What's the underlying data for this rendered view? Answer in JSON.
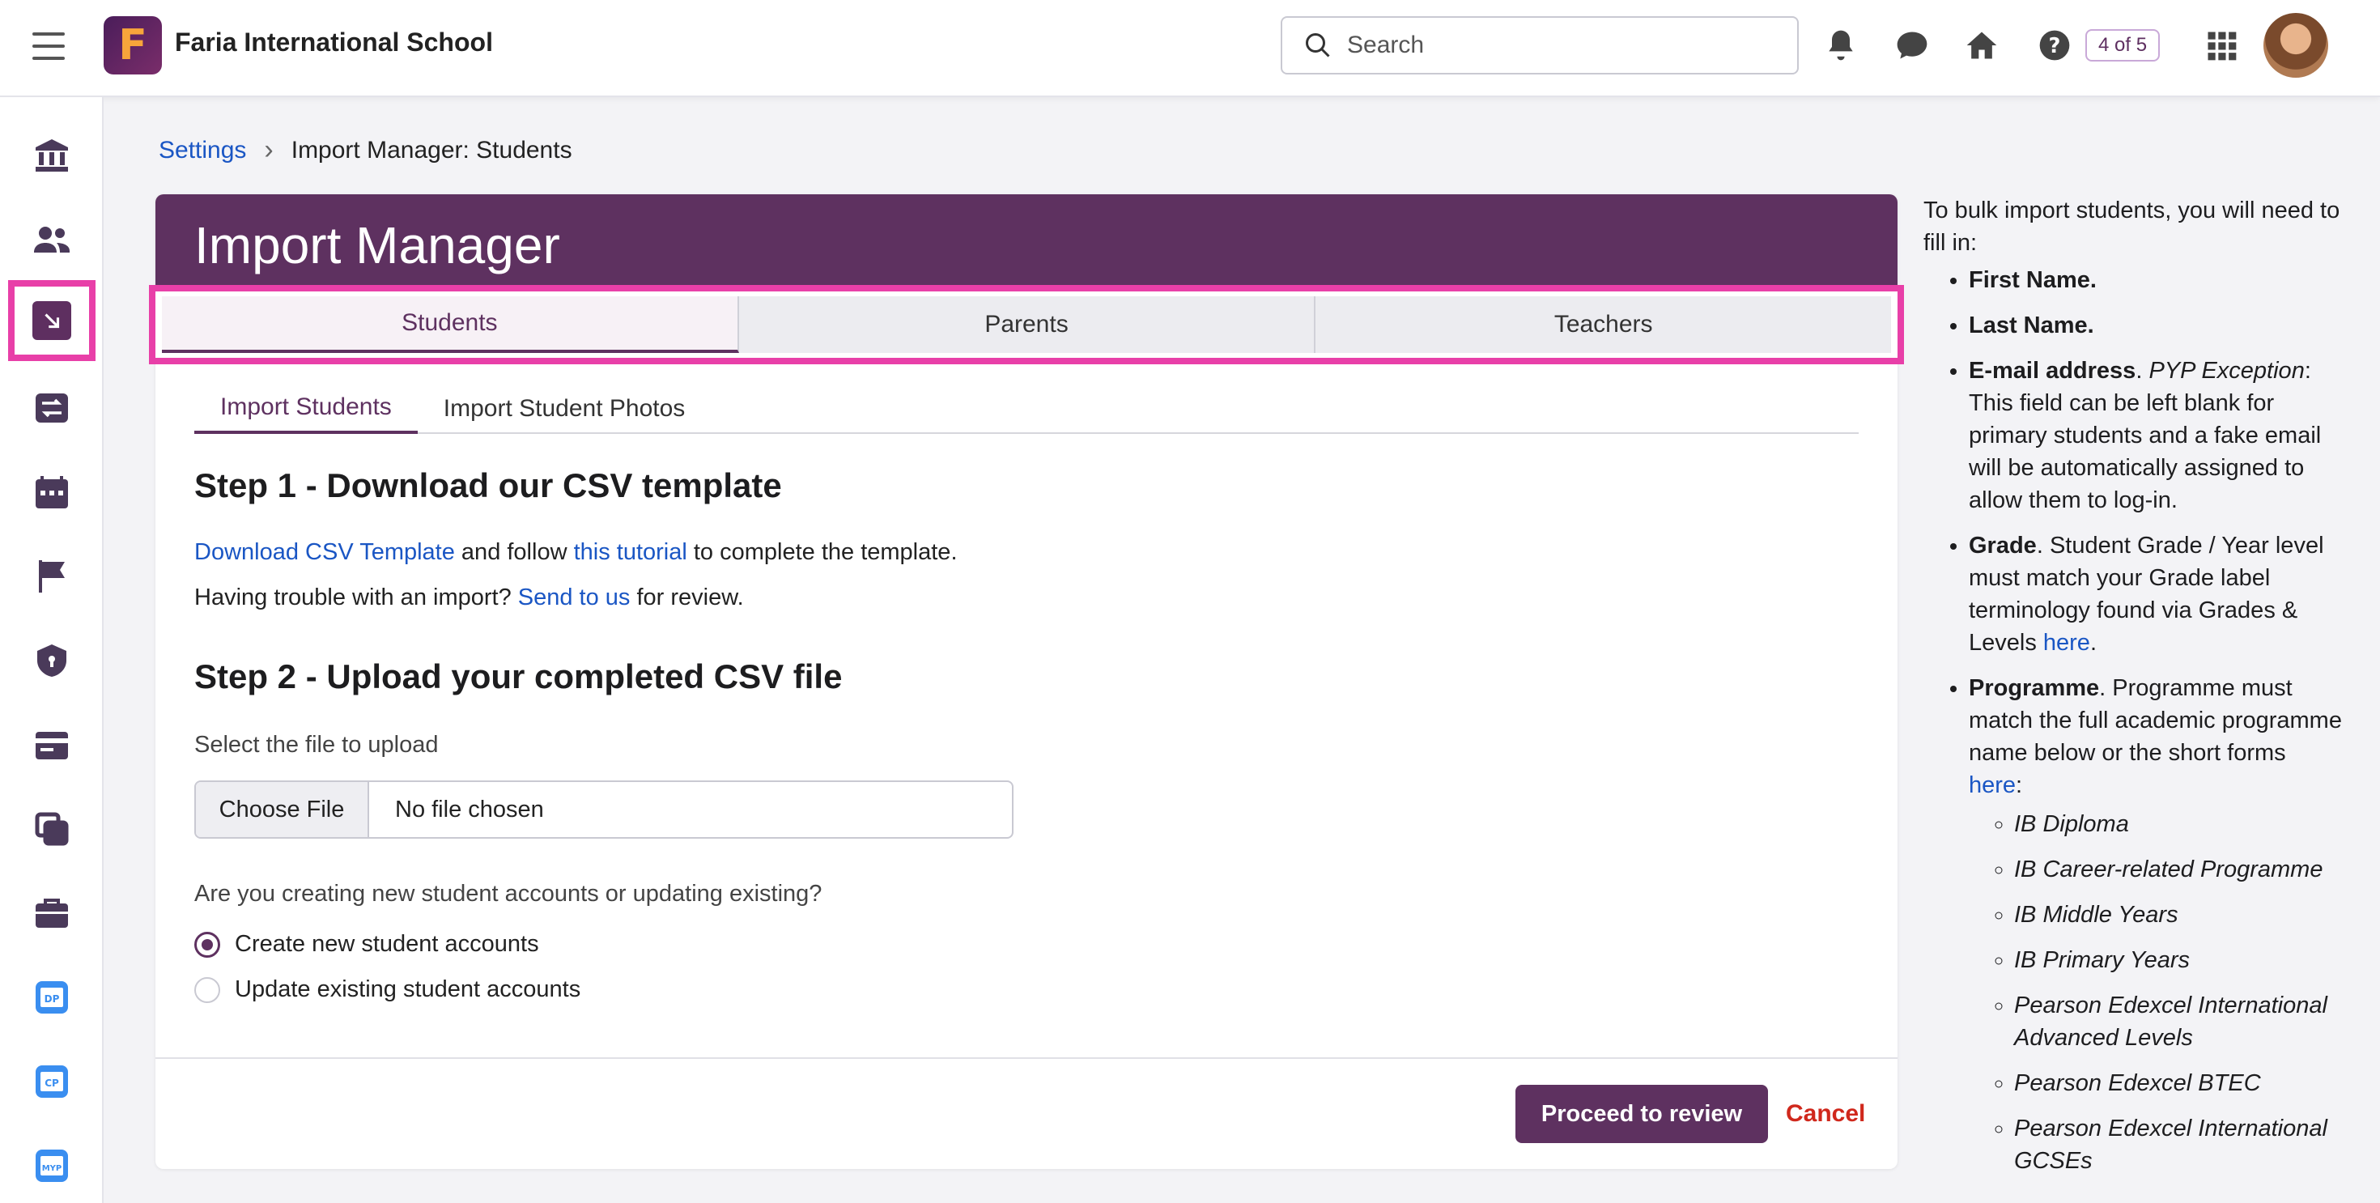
{
  "app": {
    "school_name": "Faria International School",
    "logo_letter": "F",
    "counter": "4 of 5"
  },
  "search": {
    "placeholder": "Search"
  },
  "breadcrumb": {
    "parent": "Settings",
    "current": "Import Manager: Students"
  },
  "card": {
    "title": "Import Manager",
    "tabs": [
      "Students",
      "Parents",
      "Teachers"
    ],
    "active_tab": "Students",
    "subtabs": [
      "Import Students",
      "Import Student Photos"
    ]
  },
  "step1": {
    "title": "Step 1 - Download our CSV template",
    "link1": "Download CSV Template",
    "text1": " and follow ",
    "link2": "this tutorial",
    "text2": " to complete the template.",
    "trouble": "Having trouble with an import? ",
    "link3": "Send to us",
    "text3": " for review."
  },
  "step2": {
    "title": "Step 2 - Upload your completed CSV file",
    "file_label": "Select the file to upload",
    "choose_button": "Choose File",
    "file_status": "No file chosen",
    "question": "Are you creating new student accounts or updating existing?",
    "options": [
      "Create new student accounts",
      "Update existing student accounts"
    ],
    "selected": "Create new student accounts"
  },
  "actions": {
    "proceed": "Proceed to review",
    "cancel": "Cancel"
  },
  "help": {
    "intro": "To bulk import students, you will need to fill in:",
    "first_name": "First Name.",
    "last_name": "Last Name.",
    "email_bold": "E-mail address",
    "email_dot": ". ",
    "email_italic": "PYP Exception",
    "email_rest": ": This field can be left blank for primary students and a fake email will be automatically assigned to allow them to log-in.",
    "grade_bold": "Grade",
    "grade_rest": ". Student Grade / Year level must match your Grade label terminology found via Grades & Levels ",
    "grade_link": "here",
    "grade_end": ".",
    "programme_bold": "Programme",
    "programme_rest": ". Programme must match the full academic programme name below or the short forms ",
    "programme_link": "here",
    "programme_end": ":",
    "programmes": [
      "IB Diploma",
      "IB Career-related Programme",
      "IB Middle Years",
      "IB Primary Years",
      "Pearson Edexcel International Advanced Levels",
      "Pearson Edexcel BTEC",
      "Pearson Edexcel International GCSEs"
    ]
  },
  "sidebar": {
    "icons": [
      "bank-icon",
      "users-icon",
      "import-icon",
      "swap-icon",
      "calendar-icon",
      "flag-icon",
      "shield-icon",
      "card-icon",
      "copy-icon",
      "briefcase-icon",
      "dp-icon",
      "cp-icon",
      "myp-icon"
    ],
    "badges": [
      "DP",
      "CP",
      "MYP"
    ]
  },
  "colors": {
    "brand": "#5e3160",
    "highlight": "#e83fa8",
    "link": "#1a56c4",
    "cancel": "#d0281c"
  }
}
